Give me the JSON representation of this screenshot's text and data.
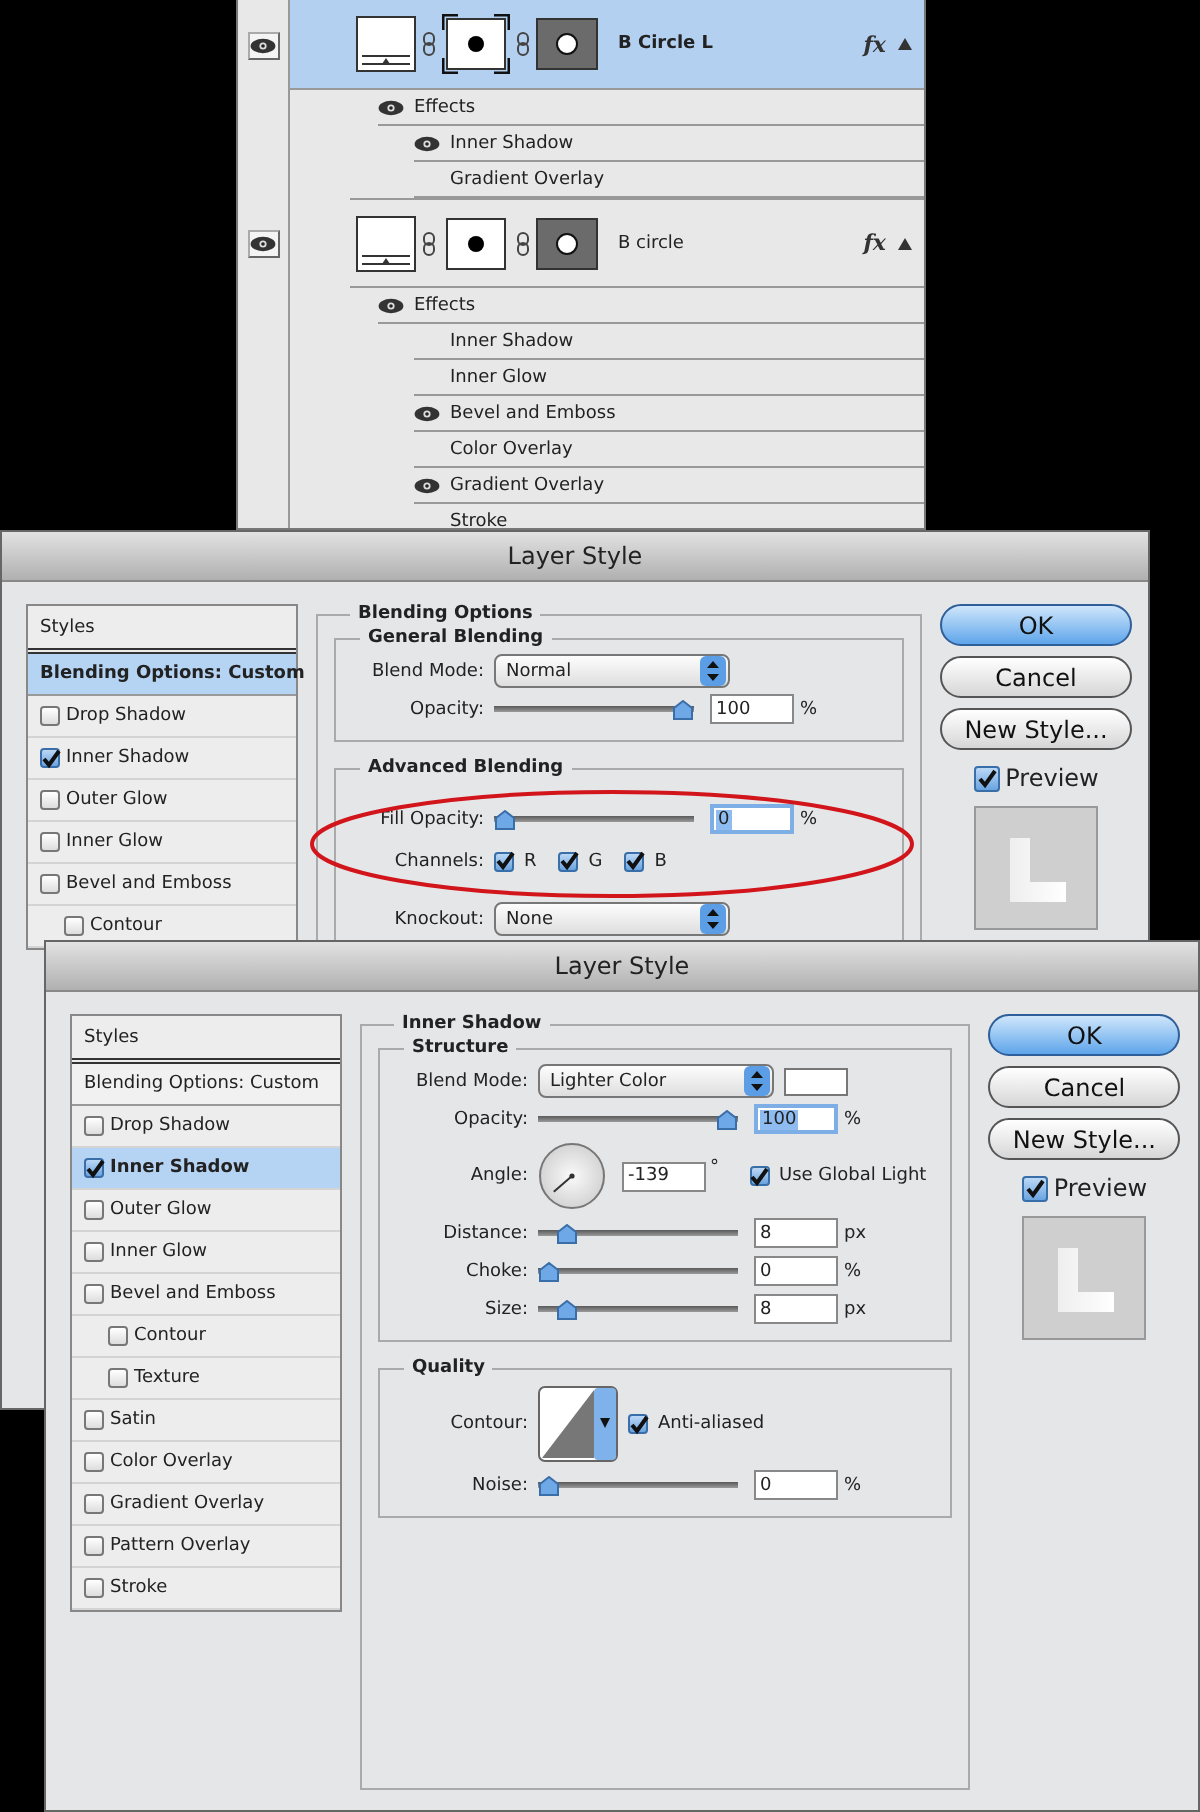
{
  "layers_panel": {
    "layers": [
      {
        "name": "B Circle L",
        "selected": true,
        "visible": true,
        "mask_active": true,
        "fx": "fx",
        "expanded": true,
        "effects_label": "Effects",
        "effects_visible": true,
        "effects": [
          {
            "name": "Inner Shadow",
            "visible": true
          },
          {
            "name": "Gradient Overlay",
            "visible": false
          }
        ]
      },
      {
        "name": "B circle",
        "selected": false,
        "visible": true,
        "mask_active": false,
        "fx": "fx",
        "expanded": true,
        "effects_label": "Effects",
        "effects_visible": true,
        "effects": [
          {
            "name": "Inner Shadow",
            "visible": false
          },
          {
            "name": "Inner Glow",
            "visible": false
          },
          {
            "name": "Bevel and Emboss",
            "visible": true
          },
          {
            "name": "Color Overlay",
            "visible": false
          },
          {
            "name": "Gradient Overlay",
            "visible": true
          },
          {
            "name": "Stroke",
            "visible": false
          }
        ]
      }
    ]
  },
  "dialogs": [
    {
      "title": "Layer Style",
      "styles": [
        {
          "label": "Styles",
          "kind": "header"
        },
        {
          "label": "Blending Options: Custom",
          "kind": "option",
          "selected": true
        },
        {
          "label": "Drop Shadow",
          "kind": "effect",
          "checked": false,
          "selected": false
        },
        {
          "label": "Inner Shadow",
          "kind": "effect",
          "checked": true,
          "selected": false
        },
        {
          "label": "Outer Glow",
          "kind": "effect",
          "checked": false,
          "selected": false
        },
        {
          "label": "Inner Glow",
          "kind": "effect",
          "checked": false,
          "selected": false
        },
        {
          "label": "Bevel and Emboss",
          "kind": "effect",
          "checked": false,
          "selected": false,
          "children": [
            {
              "label": "Contour",
              "kind": "effect",
              "checked": false,
              "selected": false
            }
          ]
        }
      ],
      "panel": {
        "title": "Blending Options",
        "groups": [
          {
            "title": "General Blending",
            "annotated": false,
            "rows": [
              {
                "kind": "select",
                "label": "Blend Mode:",
                "value": "Normal"
              },
              {
                "kind": "slider",
                "label": "Opacity:",
                "level": 1,
                "value": "100",
                "unit": "%",
                "highlighted": false
              }
            ]
          },
          {
            "title": "Advanced Blending",
            "annotated": true,
            "rows": [
              {
                "kind": "slider",
                "label": "Fill Opacity:",
                "level": 0,
                "value": "0",
                "unit": "%",
                "highlighted": true
              },
              {
                "kind": "channels",
                "label": "Channels:",
                "channels": [
                  {
                    "label": "R",
                    "checked": true
                  },
                  {
                    "label": "G",
                    "checked": true
                  },
                  {
                    "label": "B",
                    "checked": true
                  }
                ]
              },
              {
                "kind": "select",
                "label": "Knockout:",
                "value": "None"
              }
            ]
          }
        ]
      },
      "buttons": [
        {
          "label": "OK",
          "default": true
        },
        {
          "label": "Cancel",
          "default": false
        },
        {
          "label": "New Style...",
          "default": false
        }
      ],
      "preview": {
        "label": "Preview",
        "checked": true
      }
    },
    {
      "title": "Layer Style",
      "styles": [
        {
          "label": "Styles",
          "kind": "header"
        },
        {
          "label": "Blending Options: Custom",
          "kind": "option",
          "selected": false
        },
        {
          "label": "Drop Shadow",
          "kind": "effect",
          "checked": false,
          "selected": false
        },
        {
          "label": "Inner Shadow",
          "kind": "effect",
          "checked": true,
          "selected": true
        },
        {
          "label": "Outer Glow",
          "kind": "effect",
          "checked": false,
          "selected": false
        },
        {
          "label": "Inner Glow",
          "kind": "effect",
          "checked": false,
          "selected": false
        },
        {
          "label": "Bevel and Emboss",
          "kind": "effect",
          "checked": false,
          "selected": false,
          "children": [
            {
              "label": "Contour",
              "kind": "effect",
              "checked": false,
              "selected": false
            },
            {
              "label": "Texture",
              "kind": "effect",
              "checked": false,
              "selected": false
            }
          ]
        },
        {
          "label": "Satin",
          "kind": "effect",
          "checked": false,
          "selected": false
        },
        {
          "label": "Color Overlay",
          "kind": "effect",
          "checked": false,
          "selected": false
        },
        {
          "label": "Gradient Overlay",
          "kind": "effect",
          "checked": false,
          "selected": false
        },
        {
          "label": "Pattern Overlay",
          "kind": "effect",
          "checked": false,
          "selected": false
        },
        {
          "label": "Stroke",
          "kind": "effect",
          "checked": false,
          "selected": false
        }
      ],
      "panel": {
        "title": "Inner Shadow",
        "groups": [
          {
            "title": "Structure",
            "annotated": false,
            "rows": [
              {
                "kind": "select",
                "label": "Blend Mode:",
                "value": "Lighter Color",
                "color": "#ffffff"
              },
              {
                "kind": "slider",
                "label": "Opacity:",
                "level": 1,
                "value": "100",
                "unit": "%",
                "highlighted": true
              },
              {
                "kind": "angle",
                "label": "Angle:",
                "value": "-139",
                "unit": "°",
                "option": {
                  "label": "Use Global Light",
                  "checked": true
                }
              },
              {
                "kind": "slider",
                "label": "Distance:",
                "level": 0.1,
                "value": "8",
                "unit": "px",
                "highlighted": false
              },
              {
                "kind": "slider",
                "label": "Choke:",
                "level": 0,
                "value": "0",
                "unit": "%",
                "highlighted": false
              },
              {
                "kind": "slider",
                "label": "Size:",
                "level": 0.1,
                "value": "8",
                "unit": "px",
                "highlighted": false
              }
            ]
          },
          {
            "title": "Quality",
            "annotated": false,
            "rows": [
              {
                "kind": "contour",
                "label": "Contour:",
                "option": {
                  "label": "Anti-aliased",
                  "checked": true
                }
              },
              {
                "kind": "slider",
                "label": "Noise:",
                "level": 0,
                "value": "0",
                "unit": "%",
                "highlighted": false
              }
            ]
          }
        ]
      },
      "buttons": [
        {
          "label": "OK",
          "default": true
        },
        {
          "label": "Cancel",
          "default": false
        },
        {
          "label": "New Style...",
          "default": false
        }
      ],
      "preview": {
        "label": "Preview",
        "checked": true
      }
    }
  ]
}
